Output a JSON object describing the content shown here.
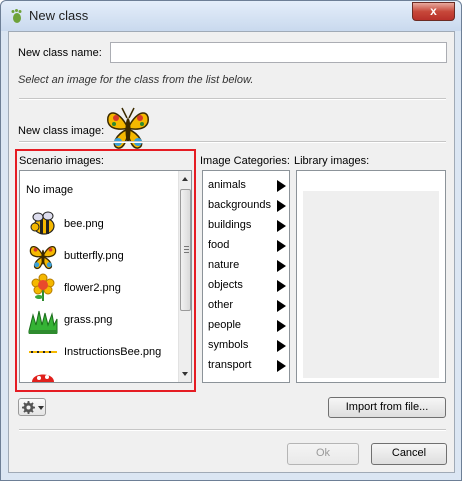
{
  "window": {
    "title": "New class",
    "close_label": "x"
  },
  "form": {
    "class_name_label": "New class name:",
    "class_name_value": "",
    "instruction": "Select an image for the class from the list below.",
    "class_image_label": "New class image:"
  },
  "scenario": {
    "label": "Scenario images:",
    "no_image": "No image",
    "items": [
      {
        "name": "bee.png"
      },
      {
        "name": "butterfly.png"
      },
      {
        "name": "flower2.png"
      },
      {
        "name": "grass.png"
      },
      {
        "name": "InstructionsBee.png"
      }
    ]
  },
  "categories": {
    "label": "Image Categories:",
    "items": [
      "animals",
      "backgrounds",
      "buildings",
      "food",
      "nature",
      "objects",
      "other",
      "people",
      "symbols",
      "transport"
    ]
  },
  "library": {
    "label": "Library images:"
  },
  "buttons": {
    "import": "Import from file...",
    "ok": "Ok",
    "cancel": "Cancel"
  },
  "colors": {
    "highlight": "#e51c23",
    "close": "#c7483a",
    "window_frame": "#dbe6f3"
  }
}
